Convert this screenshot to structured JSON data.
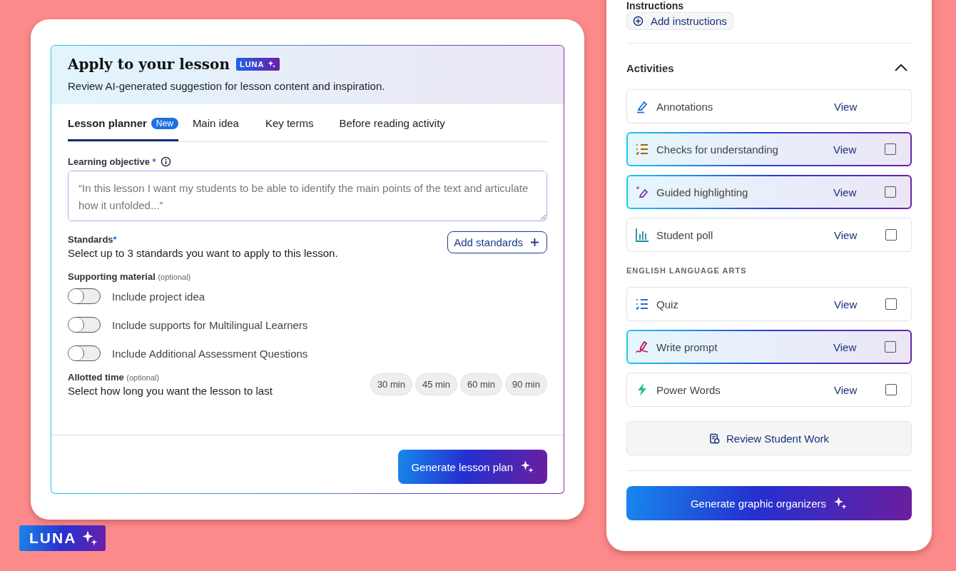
{
  "lesson_card": {
    "title": "Apply to your lesson",
    "badge": "LUNA",
    "subtitle": "Review AI-generated suggestion for lesson content and inspiration.",
    "tabs": [
      {
        "label": "Lesson planner",
        "badge": "New",
        "selected": true
      },
      {
        "label": "Main idea",
        "selected": false
      },
      {
        "label": "Key terms",
        "selected": false
      },
      {
        "label": "Before reading activity",
        "selected": false
      }
    ],
    "objective": {
      "label": "Learning objective",
      "required": "*",
      "placeholder": "“In this lesson I want my students to be able to identify the main points of the text and articulate how it unfolded...”"
    },
    "standards": {
      "label": "Standards",
      "required": "*",
      "description": "Select up to 3 standards you want to apply to this lesson.",
      "button": "Add standards"
    },
    "supporting": {
      "label": "Supporting material",
      "note": "(optional)",
      "toggles": [
        {
          "label": "Include project idea",
          "on": false
        },
        {
          "label": "Include supports for Multilingual Learners",
          "on": false
        },
        {
          "label": "Include Additional Assessment Questions",
          "on": false
        }
      ]
    },
    "time": {
      "label": "Allotted time",
      "note": "(optional)",
      "description": "Select how long you want the lesson to last",
      "options": [
        {
          "label": "30 min",
          "selected": false
        },
        {
          "label": "45 min",
          "selected": false
        },
        {
          "label": "60 min",
          "selected": false
        },
        {
          "label": "90 min",
          "selected": false
        }
      ]
    },
    "generate_button": "Generate lesson plan"
  },
  "side_panel": {
    "instructions_label": "Instructions",
    "add_instructions": "Add instructions",
    "activities_title": "Activities",
    "expanded": true,
    "activities": [
      {
        "name": "Annotations",
        "action": "View",
        "highlighted": false
      },
      {
        "name": "Checks for understanding",
        "action": "View",
        "highlighted": true,
        "checked": false
      },
      {
        "name": "Guided highlighting",
        "action": "View",
        "highlighted": true,
        "checked": false
      },
      {
        "name": "Student poll",
        "action": "View",
        "highlighted": false,
        "checked": false
      }
    ],
    "section_title": "ENGLISH LANGUAGE ARTS",
    "section_activities": [
      {
        "name": "Quiz",
        "action": "View",
        "highlighted": false,
        "checked": false
      },
      {
        "name": "Write prompt",
        "action": "View",
        "highlighted": true,
        "checked": false
      },
      {
        "name": "Power Words",
        "action": "View",
        "highlighted": false,
        "checked": false
      }
    ],
    "review_button": "Review Student Work",
    "generate_button": "Generate graphic organizers"
  },
  "brand_badge": "LUNA"
}
